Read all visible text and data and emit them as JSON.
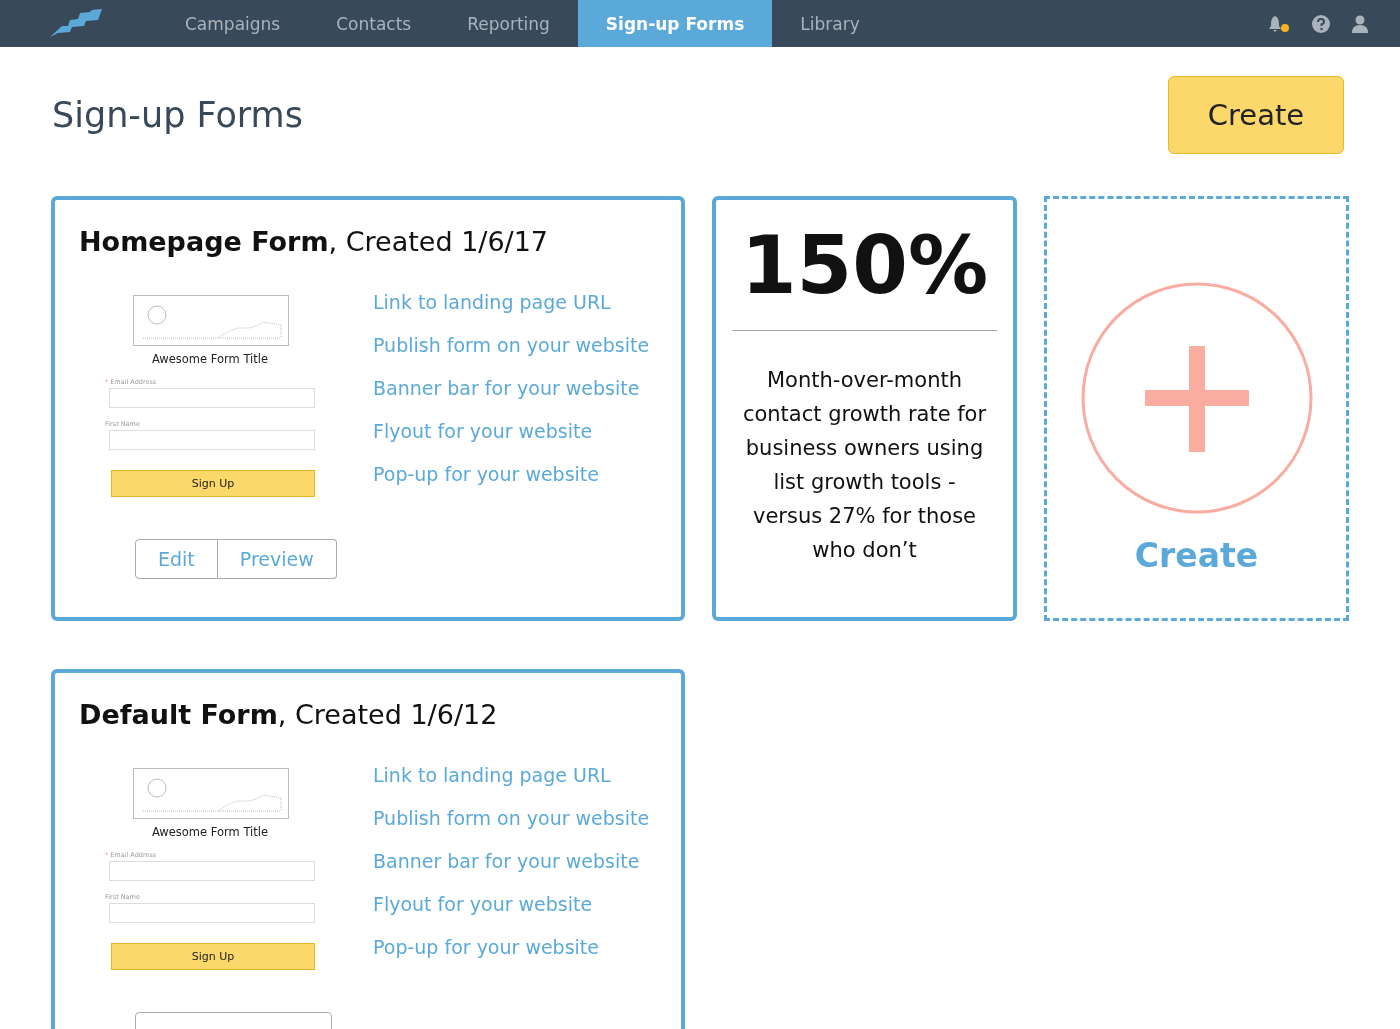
{
  "nav": {
    "items": [
      {
        "label": "Campaigns",
        "selected": false
      },
      {
        "label": "Contacts",
        "selected": false
      },
      {
        "label": "Reporting",
        "selected": false
      },
      {
        "label": "Sign-up Forms",
        "selected": true
      },
      {
        "label": "Library",
        "selected": false
      }
    ],
    "has_notification": true
  },
  "page": {
    "title": "Sign-up Forms",
    "create_button": "Create"
  },
  "forms": [
    {
      "name": "Homepage Form",
      "created": ", Created 1/6/17",
      "preview": {
        "title": "Awesome Form Title",
        "required_mark": "*",
        "email_label": "Email Address",
        "first_name_label": "First Name",
        "button": "Sign Up"
      },
      "links": [
        "Link to landing page URL",
        "Publish form on your website",
        "Banner bar for your website",
        "Flyout for your website",
        "Pop-up for your website"
      ],
      "actions": [
        "Edit",
        "Preview"
      ]
    },
    {
      "name": "Default Form",
      "created": ", Created 1/6/12",
      "preview": {
        "title": "Awesome Form Title",
        "required_mark": "*",
        "email_label": "Email Address",
        "first_name_label": "First Name",
        "button": "Sign Up"
      },
      "links": [
        "Link to landing page URL",
        "Publish form on your website",
        "Banner bar for your website",
        "Flyout for your website",
        "Pop-up for your website"
      ]
    }
  ],
  "stat": {
    "value": "150%",
    "description": "Month-over-month contact growth rate for business owners using list growth tools - versus 27% for those who don’t"
  },
  "create_card": {
    "label": "Create"
  }
}
